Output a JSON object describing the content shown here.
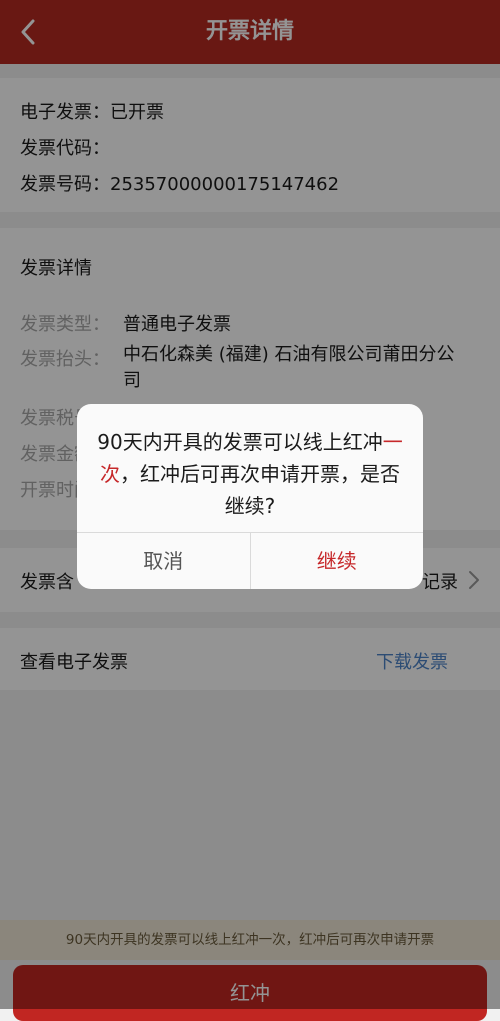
{
  "header": {
    "title": "开票详情"
  },
  "summary": {
    "status_label": "电子发票：",
    "status_value": "已开票",
    "code_label": "发票代码：",
    "code_value": "",
    "number_label": "发票号码：",
    "number_value": "25357000000175147462"
  },
  "details": {
    "section_title": "发票详情",
    "fields": [
      {
        "label": "发票类型：",
        "value": "普通电子发票"
      },
      {
        "label": "发票抬头：",
        "value": "中石化森美 (福建) 石油有限公司莆田分公司"
      },
      {
        "label": "发票税号：",
        "value": ""
      },
      {
        "label": "发票金额：",
        "value": ""
      },
      {
        "label": "开票时间：",
        "value": ""
      }
    ]
  },
  "records": {
    "label_left": "发票含",
    "label_right": "记录"
  },
  "electronic": {
    "label": "查看电子发票",
    "download_label": "下载发票"
  },
  "notice": {
    "text": "90天内开具的发票可以线上红冲一次，红冲后可再次申请开票"
  },
  "primary_button": {
    "label": "红冲"
  },
  "dialog": {
    "message_part1": "90天内开具的发票可以线上红冲",
    "message_highlight": "一次",
    "message_part2": "，红冲后可再次申请开票，是否继续?",
    "cancel_label": "取消",
    "confirm_label": "继续"
  },
  "colors": {
    "brand_red": "#b52a22",
    "link_blue": "#4c83c9",
    "highlight_red": "#c6282a"
  }
}
